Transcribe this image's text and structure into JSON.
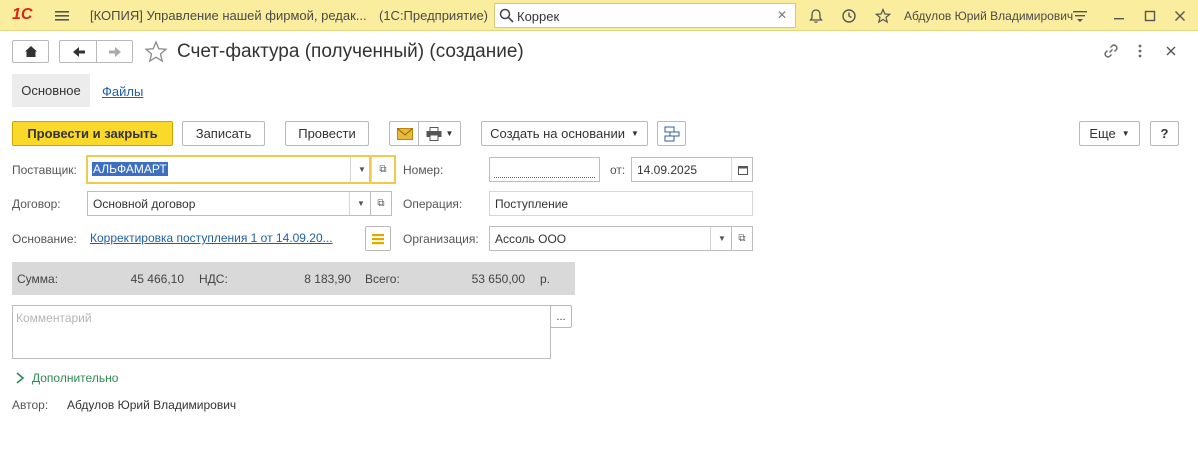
{
  "titlebar": {
    "app_logo": "1С",
    "title": "[КОПИЯ] Управление нашей фирмой, редак...",
    "platform": "(1С:Предприятие)",
    "search_value": "Коррек",
    "user": "Абдулов Юрий Владимирович"
  },
  "nav": {
    "page_title": "Счет-фактура (полученный) (создание)"
  },
  "tabs": [
    {
      "label": "Основное",
      "active": true
    },
    {
      "label": "Файлы",
      "active": false
    }
  ],
  "toolbar": {
    "post_close": "Провести и закрыть",
    "save": "Записать",
    "post": "Провести",
    "create_basis": "Создать на основании",
    "more": "Еще",
    "help": "?"
  },
  "form": {
    "supplier_label": "Поставщик:",
    "supplier_value": "АЛЬФАМАРТ",
    "contract_label": "Договор:",
    "contract_value": "Основной договор",
    "basis_label": "Основание:",
    "basis_value": "Корректировка поступления 1 от 14.09.20...",
    "number_label": "Номер:",
    "number_value": "",
    "date_label": "от:",
    "date_value": "14.09.2025",
    "operation_label": "Операция:",
    "operation_value": "Поступление",
    "org_label": "Организация:",
    "org_value": "Ассоль ООО"
  },
  "totals": {
    "sum_label": "Сумма:",
    "sum_value": "45 466,10",
    "vat_label": "НДС:",
    "vat_value": "8 183,90",
    "total_label": "Всего:",
    "total_value": "53 650,00",
    "currency": "р."
  },
  "comment": {
    "placeholder": "Комментарий",
    "more_btn": "..."
  },
  "additional": "Дополнительно",
  "author": {
    "label": "Автор:",
    "value": "Абдулов Юрий Владимирович"
  },
  "colors": {
    "titlebar_bg": "#fbed9e",
    "primary_button": "#fbd92b",
    "link": "#1f5fa6",
    "logo": "#d9261c",
    "additional_green": "#2e8b57"
  }
}
